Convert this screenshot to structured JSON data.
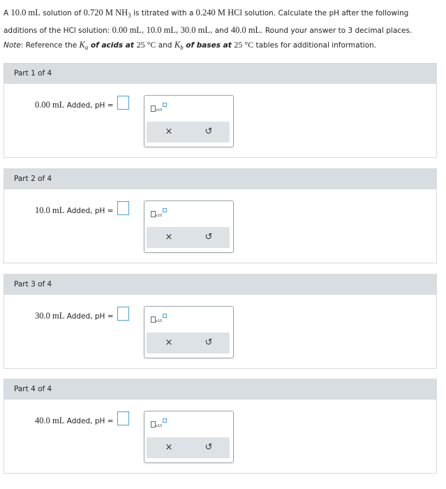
{
  "problem": {
    "intro_a": "A ",
    "vol": "10.0 mL",
    "intro_b": " solution of ",
    "conc_nh3": "0.720 M NH",
    "sub3": "3",
    "intro_c": " is titrated with a ",
    "conc_hcl": "0.240 M HCl",
    "intro_d": " solution. Calculate the pH after the following additions of the HCl solution: ",
    "v1": "0.00 mL",
    "sep1": ", ",
    "v2": "10.0 mL",
    "sep2": ", ",
    "v3": "30.0 mL",
    "sep3": ", and ",
    "v4": "40.0 mL",
    "intro_e": ". Round your answer to 3 decimal places."
  },
  "note": {
    "label": "Note",
    "text_a": ": Reference the ",
    "ka": "K",
    "ka_sub": "a",
    "acids": " of acids at ",
    "temp1": "25 °C",
    "and": " and ",
    "kb": "K",
    "kb_sub": "b",
    "bases": " of bases at ",
    "temp2": "25 °C",
    "text_b": " tables for additional information."
  },
  "parts": [
    {
      "header": "Part 1 of 4",
      "volume": "0.00 mL",
      "label_rest": " Added, pH ="
    },
    {
      "header": "Part 2 of 4",
      "volume": "10.0 mL",
      "label_rest": " Added, pH ="
    },
    {
      "header": "Part 3 of 4",
      "volume": "30.0 mL",
      "label_rest": " Added, pH ="
    },
    {
      "header": "Part 4 of 4",
      "volume": "40.0 mL",
      "label_rest": " Added, pH ="
    }
  ],
  "tools": {
    "x10_text": "x10",
    "clear_symbol": "×",
    "undo_symbol": "↺"
  }
}
